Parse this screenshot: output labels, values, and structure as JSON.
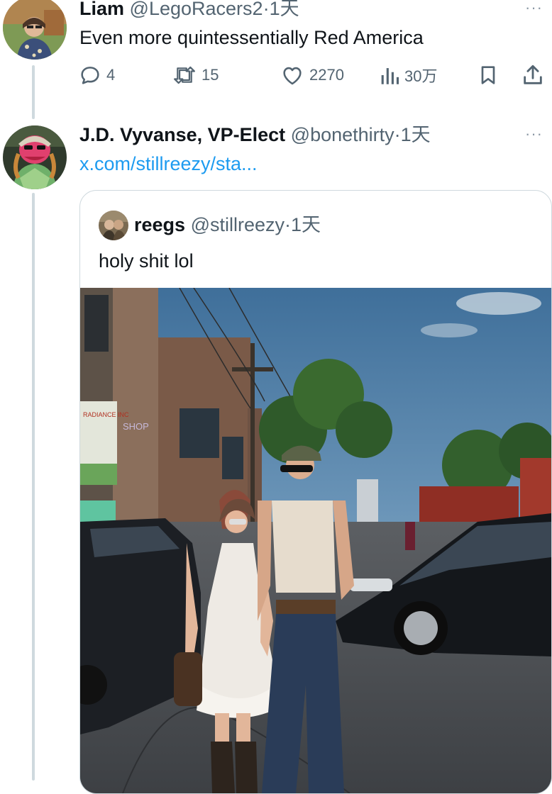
{
  "tweet1": {
    "name": "Liam",
    "handle": "@LegoRacers2",
    "sep": "·",
    "time": "1天",
    "text": "Even more quintessentially Red America",
    "more": "···",
    "actions": {
      "replies": "4",
      "retweets": "15",
      "likes": "2270",
      "views": "30万"
    }
  },
  "tweet2": {
    "name": "J.D. Vyvanse, VP-Elect",
    "handle": "@bonethirty",
    "sep": "·",
    "time": "1天",
    "link": "x.com/stillreezy/sta...",
    "more": "···"
  },
  "quote": {
    "name": "reegs",
    "handle": "@stillreezy",
    "sep": "·",
    "time": "1天",
    "text": "holy shit lol",
    "photo_signs": [
      "RADIANCE INC",
      "SHOP"
    ]
  },
  "icons": [
    "reply-icon",
    "retweet-icon",
    "like-icon",
    "views-icon",
    "bookmark-icon",
    "share-icon"
  ],
  "colors": {
    "text": "#0f1419",
    "secondary": "#536471",
    "link": "#1d9bf0",
    "border": "#cfd9de"
  }
}
